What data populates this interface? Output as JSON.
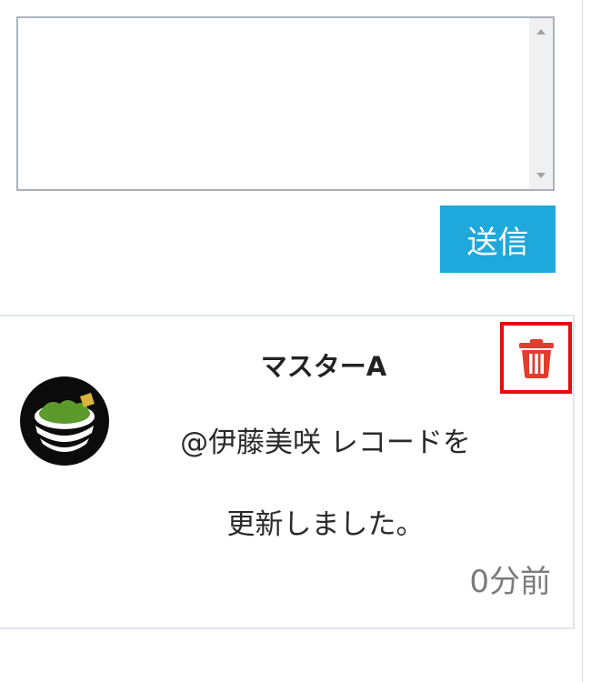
{
  "comment_form": {
    "textarea_value": "",
    "send_label": "送信"
  },
  "comment": {
    "author": "マスターA",
    "mention": "@伊藤美咲",
    "text_line1_rest": " レコードを",
    "text_line2": "更新しました。",
    "time": "0分前",
    "delete_icon": "trash-icon"
  },
  "colors": {
    "send_button": "#1fa8dc",
    "delete_icon": "#e33c2e",
    "highlight": "#e30e0e",
    "avatar_green": "#5c9a2c"
  }
}
